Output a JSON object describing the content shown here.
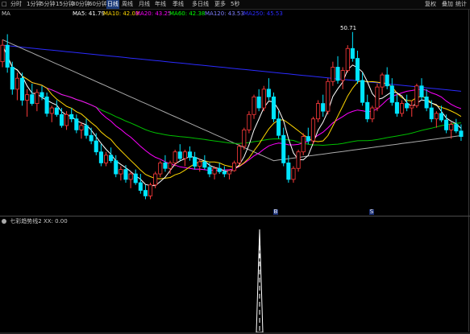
{
  "toolbar": {
    "tabs": [
      "分时",
      "1分钟",
      "5分钟",
      "15分钟",
      "30分钟",
      "60分钟",
      "日线",
      "周线",
      "月线",
      "年线",
      "季线",
      "多日线",
      "更多"
    ],
    "extra_tab": "5秒",
    "active_tab": "日线",
    "right_labels": [
      "复权",
      "叠加",
      "统计"
    ],
    "square_icon": "square-icon"
  },
  "ma_legend": {
    "prefix": "MA",
    "items": [
      {
        "label": "MA5: 41.79",
        "color": "#ffffff"
      },
      {
        "label": "MA10: 42.03",
        "color": "#ffd700"
      },
      {
        "label": "MA20: 43.25",
        "color": "#ff00ff"
      },
      {
        "label": "MA60: 42.38",
        "color": "#00ff00"
      },
      {
        "label": "MA120: 43.53",
        "color": "#7f7fff"
      },
      {
        "label": "MA250: 45.53",
        "color": "#2b2bff"
      }
    ]
  },
  "price_panel": {
    "peak_label": "50.71",
    "day_markers": [
      "B",
      "S"
    ],
    "candles": [
      [
        48.0,
        50.0,
        47.5,
        49.5
      ],
      [
        49.5,
        50.5,
        47.0,
        47.5
      ],
      [
        47.5,
        48.0,
        45.0,
        45.5
      ],
      [
        45.5,
        47.0,
        44.5,
        46.5
      ],
      [
        46.5,
        47.0,
        44.0,
        44.5
      ],
      [
        44.5,
        45.5,
        43.0,
        45.0
      ],
      [
        45.0,
        46.0,
        44.0,
        44.2
      ],
      [
        44.2,
        45.5,
        43.5,
        45.2
      ],
      [
        45.2,
        45.8,
        44.5,
        44.8
      ],
      [
        44.8,
        45.2,
        43.0,
        43.3
      ],
      [
        43.3,
        44.0,
        42.5,
        43.8
      ],
      [
        43.8,
        44.5,
        43.0,
        43.2
      ],
      [
        43.2,
        43.8,
        42.0,
        42.2
      ],
      [
        42.2,
        43.5,
        41.8,
        43.2
      ],
      [
        43.2,
        43.8,
        42.5,
        42.8
      ],
      [
        42.8,
        43.2,
        41.5,
        41.8
      ],
      [
        41.8,
        42.5,
        41.0,
        42.2
      ],
      [
        42.2,
        42.8,
        41.0,
        41.3
      ],
      [
        41.3,
        42.0,
        40.5,
        40.8
      ],
      [
        40.8,
        41.5,
        39.5,
        39.8
      ],
      [
        39.8,
        40.5,
        38.5,
        38.8
      ],
      [
        38.8,
        39.8,
        38.5,
        39.5
      ],
      [
        39.5,
        40.2,
        38.8,
        39.0
      ],
      [
        39.0,
        39.5,
        37.5,
        37.8
      ],
      [
        37.8,
        38.5,
        37.2,
        38.2
      ],
      [
        38.2,
        38.6,
        37.0,
        37.3
      ],
      [
        37.3,
        38.0,
        36.5,
        37.8
      ],
      [
        37.8,
        38.2,
        36.8,
        37.0
      ],
      [
        37.0,
        37.8,
        36.0,
        36.3
      ],
      [
        36.3,
        36.8,
        35.5,
        35.8
      ],
      [
        35.8,
        37.0,
        35.5,
        36.8
      ],
      [
        36.8,
        38.0,
        36.5,
        37.8
      ],
      [
        37.8,
        39.0,
        37.5,
        38.8
      ],
      [
        38.8,
        39.5,
        38.0,
        38.3
      ],
      [
        38.3,
        39.0,
        37.8,
        38.8
      ],
      [
        38.8,
        40.0,
        38.5,
        39.8
      ],
      [
        39.8,
        40.5,
        39.0,
        39.2
      ],
      [
        39.2,
        40.0,
        38.5,
        39.8
      ],
      [
        39.8,
        40.3,
        39.0,
        39.3
      ],
      [
        39.3,
        39.8,
        38.2,
        38.5
      ],
      [
        38.5,
        39.2,
        38.0,
        38.9
      ],
      [
        38.9,
        39.5,
        38.2,
        38.4
      ],
      [
        38.4,
        38.8,
        37.5,
        37.8
      ],
      [
        37.8,
        38.5,
        37.3,
        38.3
      ],
      [
        38.3,
        38.8,
        37.8,
        38.0
      ],
      [
        38.0,
        38.5,
        37.5,
        37.8
      ],
      [
        37.8,
        38.2,
        37.3,
        38.1
      ],
      [
        38.1,
        39.0,
        38.0,
        38.8
      ],
      [
        38.8,
        40.5,
        38.6,
        40.3
      ],
      [
        40.3,
        42.0,
        40.0,
        41.8
      ],
      [
        41.8,
        43.5,
        41.5,
        43.2
      ],
      [
        43.2,
        45.0,
        42.8,
        44.8
      ],
      [
        44.8,
        45.5,
        43.5,
        43.8
      ],
      [
        43.8,
        45.8,
        43.5,
        45.5
      ],
      [
        45.5,
        46.5,
        44.5,
        44.8
      ],
      [
        44.8,
        45.2,
        42.5,
        42.8
      ],
      [
        42.8,
        43.5,
        41.0,
        41.3
      ],
      [
        41.3,
        42.0,
        38.5,
        38.8
      ],
      [
        38.8,
        39.5,
        37.0,
        37.3
      ],
      [
        37.3,
        38.5,
        37.0,
        38.3
      ],
      [
        38.3,
        40.0,
        38.0,
        39.8
      ],
      [
        39.8,
        41.5,
        39.5,
        41.2
      ],
      [
        41.2,
        42.0,
        40.5,
        40.8
      ],
      [
        40.8,
        43.0,
        40.5,
        42.8
      ],
      [
        42.8,
        44.5,
        42.5,
        44.2
      ],
      [
        44.2,
        45.0,
        43.0,
        43.5
      ],
      [
        43.5,
        46.5,
        43.2,
        46.2
      ],
      [
        46.2,
        48.0,
        45.8,
        47.5
      ],
      [
        47.5,
        48.5,
        46.0,
        46.3
      ],
      [
        46.3,
        47.5,
        45.5,
        47.2
      ],
      [
        47.2,
        49.5,
        47.0,
        49.2
      ],
      [
        49.2,
        50.7,
        48.0,
        48.3
      ],
      [
        48.3,
        49.0,
        46.0,
        46.3
      ],
      [
        46.3,
        47.0,
        44.0,
        44.3
      ],
      [
        44.3,
        45.0,
        42.5,
        42.8
      ],
      [
        42.8,
        44.0,
        42.5,
        43.8
      ],
      [
        43.8,
        46.0,
        43.5,
        45.7
      ],
      [
        45.7,
        47.0,
        45.0,
        46.8
      ],
      [
        46.8,
        47.5,
        45.5,
        45.8
      ],
      [
        45.8,
        46.5,
        44.0,
        44.3
      ],
      [
        44.3,
        45.0,
        43.0,
        43.3
      ],
      [
        43.3,
        44.5,
        43.0,
        44.2
      ],
      [
        44.2,
        45.0,
        43.5,
        43.8
      ],
      [
        43.8,
        44.5,
        43.0,
        44.0
      ],
      [
        44.0,
        46.0,
        43.8,
        45.8
      ],
      [
        45.8,
        46.5,
        44.5,
        44.8
      ],
      [
        44.8,
        45.5,
        43.5,
        43.8
      ],
      [
        43.8,
        44.5,
        42.5,
        42.8
      ],
      [
        42.8,
        43.5,
        42.0,
        43.3
      ],
      [
        43.3,
        44.0,
        42.5,
        42.7
      ],
      [
        42.7,
        43.2,
        41.5,
        41.8
      ],
      [
        41.8,
        42.5,
        41.0,
        42.3
      ],
      [
        42.3,
        42.8,
        41.5,
        41.7
      ],
      [
        41.7,
        42.3,
        40.8,
        41.2
      ]
    ],
    "price_range": [
      34,
      52
    ]
  },
  "indicator_panel": {
    "title": "七彩趋势线2",
    "value_text": "XX: 0.00"
  }
}
